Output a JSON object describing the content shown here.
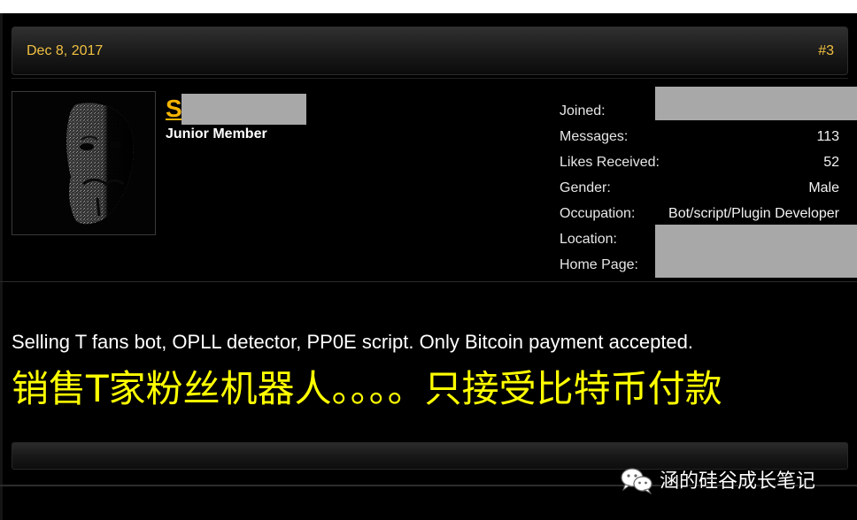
{
  "post": {
    "date": "Dec 8, 2017",
    "number": "#3",
    "author": {
      "username_visible": "S",
      "rank": "Junior Member",
      "avatar_icon": "anonymous-mask-avatar"
    },
    "user_info": [
      {
        "label": "Joined:",
        "redacted": true
      },
      {
        "label": "Messages:",
        "value": "113"
      },
      {
        "label": "Likes Received:",
        "value": "52"
      },
      {
        "label": "Gender:",
        "value": "Male"
      },
      {
        "label": "Occupation:",
        "value": "Bot/script/Plugin Developer"
      },
      {
        "label": "Location:",
        "redacted": true
      },
      {
        "label": "Home Page:",
        "redacted": true
      }
    ],
    "message": "Selling T fans bot, OPLL detector, PP0E script. Only Bitcoin payment accepted.",
    "translation": "销售T家粉丝机器人。。。。只接受比特币付款"
  },
  "watermark": {
    "icon": "wechat-icon",
    "text": "涵的硅谷成长笔记"
  },
  "colors": {
    "background": "#000000",
    "date_gold": "#f0c040",
    "username_gold": "#f5b400",
    "translation_yellow": "#ffff00",
    "redaction_gray": "#a8a8a8"
  }
}
